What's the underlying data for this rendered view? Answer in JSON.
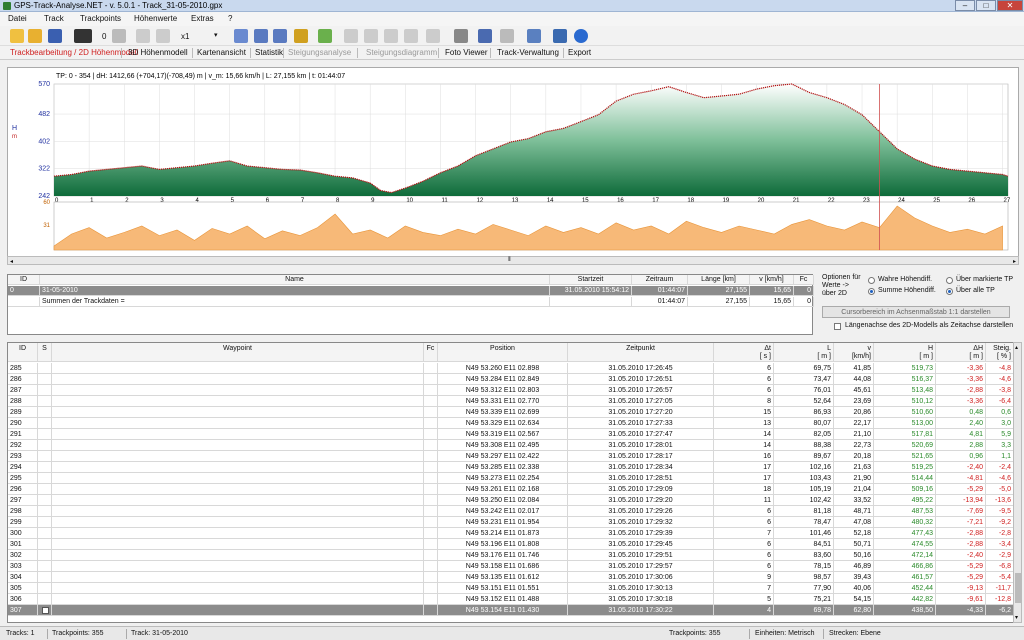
{
  "window": {
    "title": "GPS-Track-Analyse.NET  -  v. 5.0.1  -  Track_31-05-2010.gpx"
  },
  "menu": [
    "Datei",
    "Track",
    "Trackpoints",
    "Höhenwerte",
    "Extras",
    "?"
  ],
  "toolbar": {
    "zoom_label": "x1",
    "counter": "0"
  },
  "tabs": [
    "Trackbearbeitung / 2D Höhenmodell",
    "3D Höhenmodell",
    "Kartenansicht",
    "Statistik",
    "Steigungsanalyse",
    "Steigungsdiagramm",
    "Foto Viewer",
    "Track-Verwaltung",
    "Export"
  ],
  "chart_info": "TP: 0 - 354 | dH: 1412,66  (+704,17)(-708,49) m | v_m: 15,66 km/h | L: 27,155 km | t: 01:44:07",
  "chart_data": {
    "type": "area",
    "ylabel": "H",
    "ylabel_unit": "m",
    "ytick_labels": [
      "570",
      "482",
      "402",
      "322",
      "242"
    ],
    "ylim": [
      242,
      570
    ],
    "xtick_labels": [
      "0",
      "1",
      "2",
      "3",
      "4",
      "5",
      "6",
      "7",
      "8",
      "9",
      "10",
      "11",
      "12",
      "13",
      "14",
      "15",
      "16",
      "17",
      "18",
      "19",
      "20",
      "21",
      "22",
      "23",
      "24",
      "25",
      "26",
      "27"
    ],
    "xlim": [
      0,
      27.155
    ],
    "elevation": {
      "x": [
        0,
        0.5,
        1,
        1.5,
        2,
        2.5,
        3,
        3.5,
        4,
        4.5,
        5,
        5.5,
        6,
        6.5,
        7,
        7.5,
        8,
        8.5,
        9,
        9.3,
        9.6,
        10,
        10.5,
        11,
        11.5,
        12,
        12.5,
        13,
        13.5,
        14,
        14.5,
        15,
        15.5,
        16,
        16.5,
        17,
        17.5,
        18,
        18.5,
        19,
        19.5,
        20,
        20.5,
        21,
        21.5,
        22,
        22.5,
        23,
        23.5,
        24,
        24.5,
        25,
        25.5,
        26,
        26.5,
        27,
        27.155
      ],
      "y": [
        300,
        305,
        315,
        320,
        325,
        330,
        320,
        325,
        330,
        338,
        345,
        330,
        325,
        320,
        318,
        310,
        300,
        295,
        280,
        258,
        252,
        265,
        285,
        310,
        330,
        360,
        380,
        400,
        410,
        430,
        440,
        460,
        480,
        520,
        540,
        550,
        562,
        545,
        530,
        535,
        540,
        555,
        565,
        570,
        545,
        530,
        510,
        480,
        430,
        380,
        350,
        330,
        320,
        315,
        310,
        305,
        300
      ]
    },
    "slope": {
      "label": "Steigung",
      "ytick_labels": [
        "60",
        "31"
      ],
      "ylim": [
        0,
        60
      ],
      "x": [
        0,
        0.5,
        1,
        1.5,
        2,
        2.5,
        3,
        3.5,
        4,
        4.5,
        5,
        5.5,
        6,
        6.5,
        7,
        7.5,
        8,
        8.5,
        9,
        9.5,
        10,
        10.5,
        11,
        11.5,
        12,
        12.5,
        13,
        13.5,
        14,
        14.5,
        15,
        15.5,
        16,
        16.5,
        17,
        17.5,
        18,
        18.5,
        19,
        19.5,
        20,
        20.5,
        21,
        21.5,
        22,
        22.5,
        23,
        23.5,
        24,
        24.5,
        25,
        25.5,
        26,
        26.5,
        27
      ],
      "y": [
        5,
        20,
        28,
        15,
        22,
        30,
        18,
        25,
        12,
        27,
        20,
        30,
        14,
        24,
        18,
        28,
        45,
        20,
        25,
        15,
        30,
        22,
        18,
        26,
        20,
        32,
        25,
        18,
        30,
        22,
        28,
        20,
        34,
        25,
        30,
        20,
        36,
        28,
        22,
        30,
        25,
        20,
        32,
        38,
        30,
        25,
        35,
        28,
        55,
        40,
        30,
        22,
        26,
        20,
        30
      ]
    },
    "cursor_x": 23.5
  },
  "track_table": {
    "headers": [
      "ID",
      "Name",
      "Startzeit",
      "Zeitraum",
      "Länge  [km]",
      "v  [km/h]",
      "Fc"
    ],
    "rows": [
      [
        "0",
        "31-05-2010",
        "31.05.2010 15:54:12",
        "01:44:07",
        "27,155",
        "15,65",
        "0"
      ],
      [
        "",
        "Summen der Trackdaten =",
        "",
        "01:44:07",
        "27,155",
        "15,65",
        "0"
      ]
    ]
  },
  "options": {
    "label": "Optionen für Werte -> über 2D",
    "r1": "Wahre  Höhendiff.",
    "r2": "Summe Höhendiff.",
    "r3": "Über markierte TP",
    "r4": "Über alle TP",
    "button": "Cursorbereich im Achsenmaßstab 1:1 darstellen",
    "checkbox": "Längenachse des 2D-Modells als Zeitachse darstellen"
  },
  "wp_table": {
    "headers": [
      "ID",
      "S",
      "Waypoint",
      "Fc",
      "Position",
      "Zeitpunkt",
      "Δt\n[ s ]",
      "L\n[ m ]",
      "v\n[km/h]",
      "H\n[ m ]",
      "ΔH\n[ m ]",
      "Steig.\n[ % ]"
    ],
    "rows": [
      [
        "285",
        "",
        "",
        "",
        "N49 53.260 E11 02.898",
        "31.05.2010 17:26:45",
        "6",
        "69,75",
        "41,85",
        "519,73",
        "-3,36",
        "-4,8"
      ],
      [
        "286",
        "",
        "",
        "",
        "N49 53.284 E11 02.849",
        "31.05.2010 17:26:51",
        "6",
        "73,47",
        "44,08",
        "516,37",
        "-3,36",
        "-4,6"
      ],
      [
        "287",
        "",
        "",
        "",
        "N49 53.312 E11 02.803",
        "31.05.2010 17:26:57",
        "6",
        "76,01",
        "45,61",
        "513,48",
        "-2,88",
        "-3,8"
      ],
      [
        "288",
        "",
        "",
        "",
        "N49 53.331 E11 02.770",
        "31.05.2010 17:27:05",
        "8",
        "52,64",
        "23,69",
        "510,12",
        "-3,36",
        "-6,4"
      ],
      [
        "289",
        "",
        "",
        "",
        "N49 53.339 E11 02.699",
        "31.05.2010 17:27:20",
        "15",
        "86,93",
        "20,86",
        "510,60",
        "0,48",
        "0,6"
      ],
      [
        "290",
        "",
        "",
        "",
        "N49 53.329 E11 02.634",
        "31.05.2010 17:27:33",
        "13",
        "80,07",
        "22,17",
        "513,00",
        "2,40",
        "3,0"
      ],
      [
        "291",
        "",
        "",
        "",
        "N49 53.319 E11 02.567",
        "31.05.2010 17:27:47",
        "14",
        "82,05",
        "21,10",
        "517,81",
        "4,81",
        "5,9"
      ],
      [
        "292",
        "",
        "",
        "",
        "N49 53.308 E11 02.495",
        "31.05.2010 17:28:01",
        "14",
        "88,38",
        "22,73",
        "520,69",
        "2,88",
        "3,3"
      ],
      [
        "293",
        "",
        "",
        "",
        "N49 53.297 E11 02.422",
        "31.05.2010 17:28:17",
        "16",
        "89,67",
        "20,18",
        "521,65",
        "0,96",
        "1,1"
      ],
      [
        "294",
        "",
        "",
        "",
        "N49 53.285 E11 02.338",
        "31.05.2010 17:28:34",
        "17",
        "102,16",
        "21,63",
        "519,25",
        "-2,40",
        "-2,4"
      ],
      [
        "295",
        "",
        "",
        "",
        "N49 53.273 E11 02.254",
        "31.05.2010 17:28:51",
        "17",
        "103,43",
        "21,90",
        "514,44",
        "-4,81",
        "-4,6"
      ],
      [
        "296",
        "",
        "",
        "",
        "N49 53.261 E11 02.168",
        "31.05.2010 17:29:09",
        "18",
        "105,19",
        "21,04",
        "509,16",
        "-5,29",
        "-5,0"
      ],
      [
        "297",
        "",
        "",
        "",
        "N49 53.250 E11 02.084",
        "31.05.2010 17:29:20",
        "11",
        "102,42",
        "33,52",
        "495,22",
        "-13,94",
        "-13,6"
      ],
      [
        "298",
        "",
        "",
        "",
        "N49 53.242 E11 02.017",
        "31.05.2010 17:29:26",
        "6",
        "81,18",
        "48,71",
        "487,53",
        "-7,69",
        "-9,5"
      ],
      [
        "299",
        "",
        "",
        "",
        "N49 53.231 E11 01.954",
        "31.05.2010 17:29:32",
        "6",
        "78,47",
        "47,08",
        "480,32",
        "-7,21",
        "-9,2"
      ],
      [
        "300",
        "",
        "",
        "",
        "N49 53.214 E11 01.873",
        "31.05.2010 17:29:39",
        "7",
        "101,46",
        "52,18",
        "477,43",
        "-2,88",
        "-2,8"
      ],
      [
        "301",
        "",
        "",
        "",
        "N49 53.196 E11 01.808",
        "31.05.2010 17:29:45",
        "6",
        "84,51",
        "50,71",
        "474,55",
        "-2,88",
        "-3,4"
      ],
      [
        "302",
        "",
        "",
        "",
        "N49 53.176 E11 01.746",
        "31.05.2010 17:29:51",
        "6",
        "83,60",
        "50,16",
        "472,14",
        "-2,40",
        "-2,9"
      ],
      [
        "303",
        "",
        "",
        "",
        "N49 53.158 E11 01.686",
        "31.05.2010 17:29:57",
        "6",
        "78,15",
        "46,89",
        "466,86",
        "-5,29",
        "-6,8"
      ],
      [
        "304",
        "",
        "",
        "",
        "N49 53.135 E11 01.612",
        "31.05.2010 17:30:06",
        "9",
        "98,57",
        "39,43",
        "461,57",
        "-5,29",
        "-5,4"
      ],
      [
        "305",
        "",
        "",
        "",
        "N49 53.151 E11 01.551",
        "31.05.2010 17:30:13",
        "7",
        "77,90",
        "40,06",
        "452,44",
        "-9,13",
        "-11,7"
      ],
      [
        "306",
        "",
        "",
        "",
        "N49 53.152 E11 01.488",
        "31.05.2010 17:30:18",
        "5",
        "75,21",
        "54,15",
        "442,82",
        "-9,61",
        "-12,8"
      ],
      [
        "307",
        "",
        "",
        "",
        "N49 53.154 E11 01.430",
        "31.05.2010 17:30:22",
        "4",
        "69,78",
        "62,80",
        "438,50",
        "-4,33",
        "-6,2"
      ]
    ]
  },
  "status": {
    "tracks": "Tracks: 1",
    "trackpoints": "Trackpoints: 355",
    "track": "Track: 31-05-2010",
    "trackpoints2": "Trackpoints: 355",
    "units": "Einheiten: Metrisch",
    "strecken": "Strecken: Ebene"
  }
}
